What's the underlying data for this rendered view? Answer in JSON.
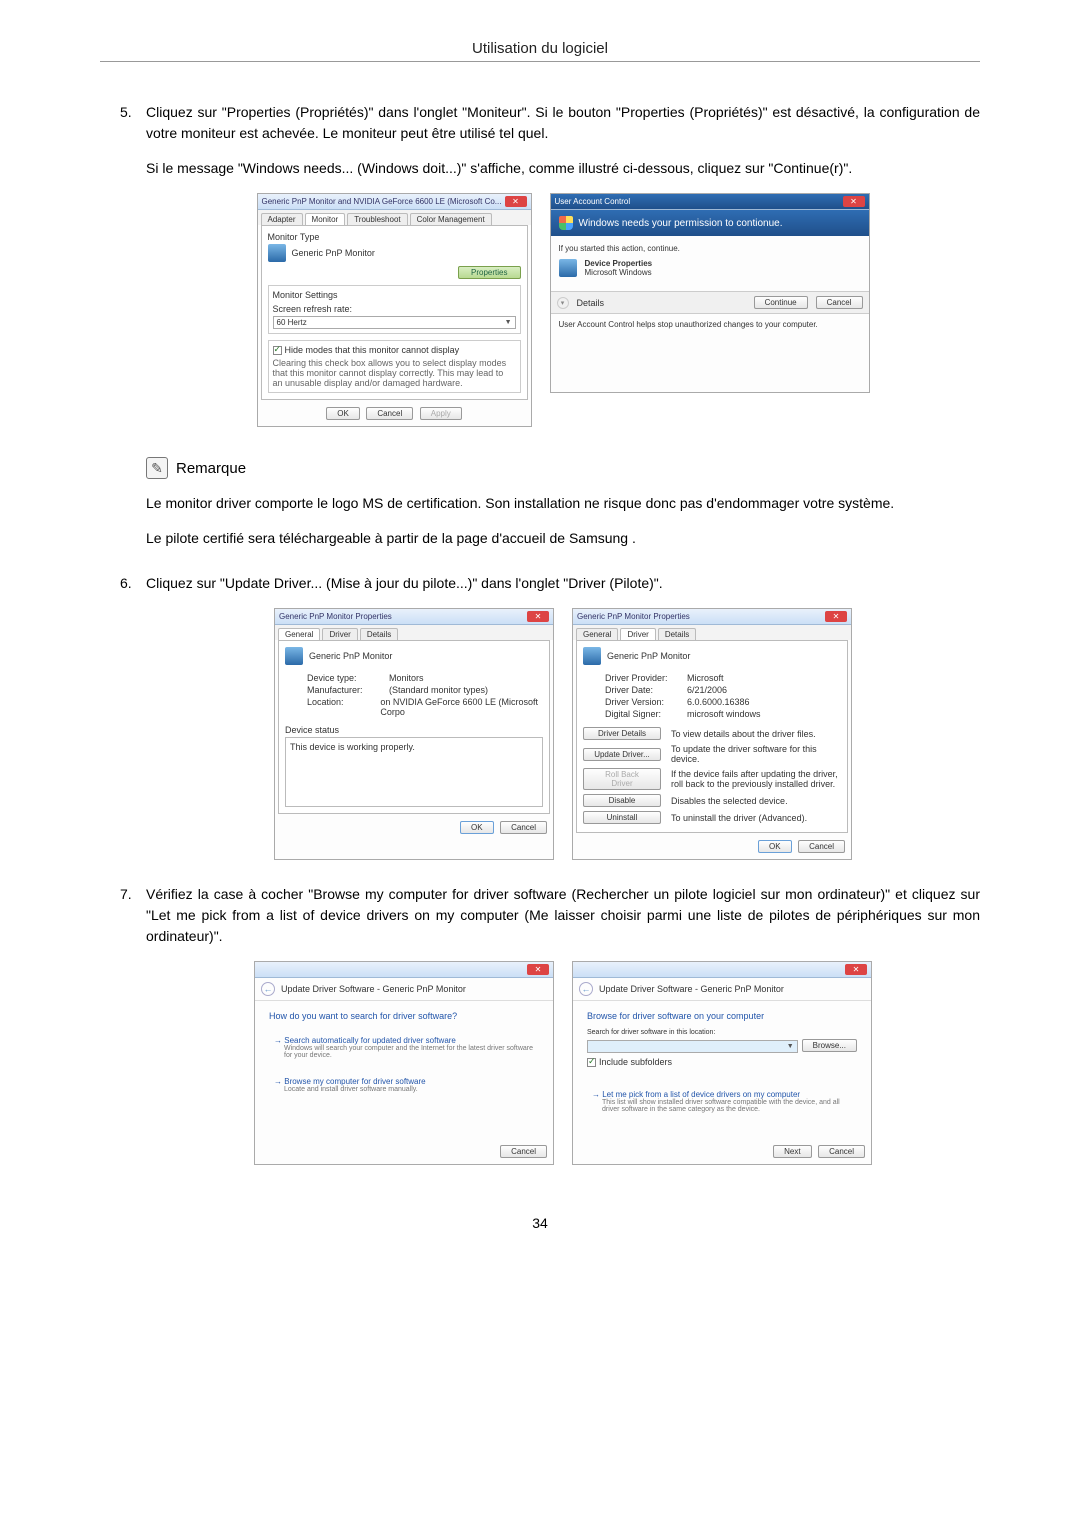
{
  "header": {
    "title": "Utilisation du logiciel"
  },
  "steps": {
    "s5": {
      "num": "5.",
      "p1": "Cliquez sur \"Properties (Propriétés)\" dans l'onglet \"Moniteur\". Si le bouton \"Properties (Propriétés)\" est désactivé, la configuration de votre moniteur est achevée. Le moniteur peut être utilisé tel quel.",
      "p2": "Si le message \"Windows needs... (Windows doit...)\" s'affiche, comme illustré ci-dessous, cliquez sur \"Continue(r)\"."
    },
    "s6": {
      "num": "6.",
      "p1": "Cliquez sur \"Update Driver... (Mise à jour du pilote...)\" dans l'onglet \"Driver (Pilote)\"."
    },
    "s7": {
      "num": "7.",
      "p1": "Vérifiez la case à cocher \"Browse my computer for driver software (Rechercher un pilote logiciel sur mon ordinateur)\" et cliquez sur \"Let me pick from a list of device drivers on my computer (Me laisser choisir parmi une liste de pilotes de périphériques sur mon ordinateur)\"."
    }
  },
  "note": {
    "label": "Remarque",
    "p1": "Le monitor driver comporte le logo MS de certification. Son installation ne risque donc pas d'endommager votre système.",
    "p2": "Le pilote certifié sera téléchargeable à partir de la page d'accueil de Samsung ."
  },
  "dlg_monitor": {
    "title": "Generic PnP Monitor and NVIDIA GeForce 6600 LE (Microsoft Co...",
    "tabs": {
      "adapter": "Adapter",
      "monitor": "Monitor",
      "trouble": "Troubleshoot",
      "color": "Color Management"
    },
    "type_label": "Monitor Type",
    "type_value": "Generic PnP Monitor",
    "properties_btn": "Properties",
    "settings_label": "Monitor Settings",
    "refresh_label": "Screen refresh rate:",
    "refresh_value": "60 Hertz",
    "hide_label": "Hide modes that this monitor cannot display",
    "hide_desc": "Clearing this check box allows you to select display modes that this monitor cannot display correctly. This may lead to an unusable display and/or damaged hardware.",
    "ok": "OK",
    "cancel": "Cancel",
    "apply": "Apply"
  },
  "dlg_uac": {
    "title": "User Account Control",
    "heading": "Windows needs your permission to contionue.",
    "if_started": "If you started this action, continue.",
    "dev_prop": "Device Properties",
    "ms_win": "Microsoft Windows",
    "details": "Details",
    "continue": "Continue",
    "cancel": "Cancel",
    "footer": "User Account Control helps stop unauthorized changes to your computer."
  },
  "dlg_general": {
    "title": "Generic PnP Monitor Properties",
    "tabs": {
      "general": "General",
      "driver": "Driver",
      "details": "Details"
    },
    "name": "Generic PnP Monitor",
    "devtype_k": "Device type:",
    "devtype_v": "Monitors",
    "mfr_k": "Manufacturer:",
    "mfr_v": "(Standard monitor types)",
    "loc_k": "Location:",
    "loc_v": "on NVIDIA GeForce 6600 LE (Microsoft Corpo",
    "status_label": "Device status",
    "status_text": "This device is working properly.",
    "ok": "OK",
    "cancel": "Cancel"
  },
  "dlg_driver": {
    "title": "Generic PnP Monitor Properties",
    "tabs": {
      "general": "General",
      "driver": "Driver",
      "details": "Details"
    },
    "name": "Generic PnP Monitor",
    "provider_k": "Driver Provider:",
    "provider_v": "Microsoft",
    "date_k": "Driver Date:",
    "date_v": "6/21/2006",
    "version_k": "Driver Version:",
    "version_v": "6.0.6000.16386",
    "signer_k": "Digital Signer:",
    "signer_v": "microsoft windows",
    "btn_details": "Driver Details",
    "desc_details": "To view details about the driver files.",
    "btn_update": "Update Driver...",
    "desc_update": "To update the driver software for this device.",
    "btn_rollback": "Roll Back Driver",
    "desc_rollback": "If the device fails after updating the driver, roll back to the previously installed driver.",
    "btn_disable": "Disable",
    "desc_disable": "Disables the selected device.",
    "btn_uninstall": "Uninstall",
    "desc_uninstall": "To uninstall the driver (Advanced).",
    "ok": "OK",
    "cancel": "Cancel"
  },
  "dlg_update1": {
    "title": "Update Driver Software - Generic PnP Monitor",
    "heading": "How do you want to search for driver software?",
    "opt1_t": "Search automatically for updated driver software",
    "opt1_d": "Windows will search your computer and the Internet for the latest driver software for your device.",
    "opt2_t": "Browse my computer for driver software",
    "opt2_d": "Locate and install driver software manually.",
    "cancel": "Cancel"
  },
  "dlg_update2": {
    "title": "Update Driver Software - Generic PnP Monitor",
    "heading": "Browse for driver software on your computer",
    "search_label": "Search for driver software in this location:",
    "browse": "Browse...",
    "include": "Include subfolders",
    "pick_t": "Let me pick from a list of device drivers on my computer",
    "pick_d": "This list will show installed driver software compatible with the device, and all driver software in the same category as the device.",
    "next": "Next",
    "cancel": "Cancel"
  },
  "footer": {
    "page": "34"
  }
}
